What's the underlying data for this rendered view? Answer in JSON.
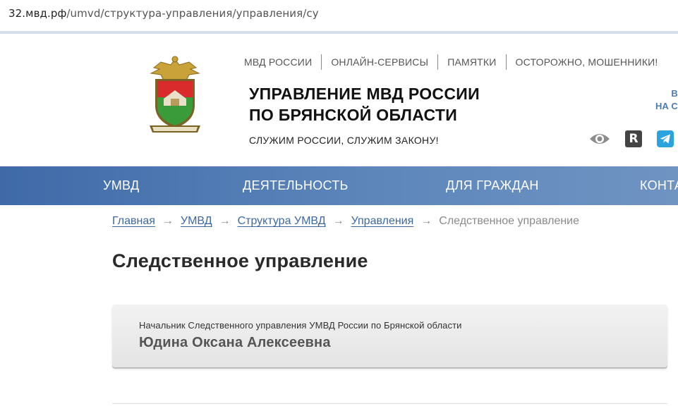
{
  "browser": {
    "url_host": "32.мвд.рф",
    "url_path": "/umvd/структура-управления/управления/су"
  },
  "header": {
    "top_nav": [
      "МВД РОССИИ",
      "ОНЛАЙН-СЕРВИСЫ",
      "ПАМЯТКИ",
      "ОСТОРОЖНО, МОШЕННИКИ!"
    ],
    "title_line1": "УПРАВЛЕНИЕ МВД РОССИИ",
    "title_line2": "ПО БРЯНСКОЙ ОБЛАСТИ",
    "slogan": "СЛУЖИМ РОССИИ, СЛУЖИМ ЗАКОНУ!",
    "promo_line1": "В",
    "promo_line2": "НА С",
    "r_icon_letter": "R",
    "icons": [
      "eye-icon",
      "r-icon",
      "telegram-icon"
    ]
  },
  "main_nav": [
    "УМВД",
    "ДЕЯТЕЛЬНОСТЬ",
    "ДЛЯ ГРАЖДАН",
    "КОНТА"
  ],
  "breadcrumbs": {
    "links": [
      "Главная",
      "УМВД",
      "Структура УМВД",
      "Управления"
    ],
    "separator": "→",
    "current": "Следственное управление"
  },
  "page": {
    "title": "Следственное управление",
    "card_role": "Начальник Следственного управления УМВД России по Брянской области",
    "card_name": "Юдина Оксана Алексеевна"
  },
  "colors": {
    "nav_bg": "#4a74ad",
    "link": "#3d69a0",
    "telegram": "#2aa3de"
  }
}
